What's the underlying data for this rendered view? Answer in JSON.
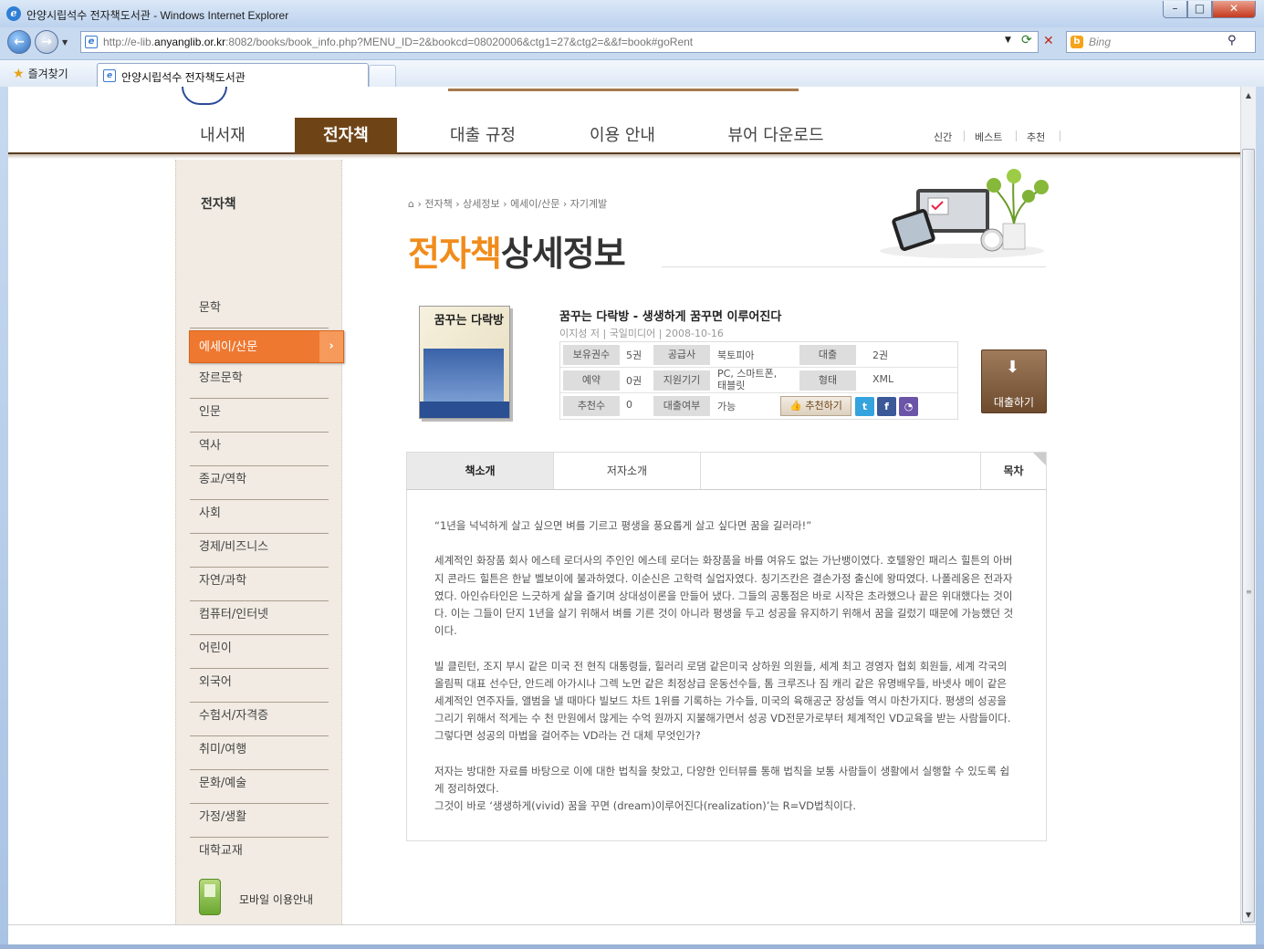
{
  "browser": {
    "window_title": "안양시립석수 전자책도서관 - Windows Internet Explorer",
    "url_prefix": "http://e-lib.",
    "url_domain": "anyanglib.or.kr",
    "url_rest": ":8082/books/book_info.php?MENU_ID=2&bookcd=08020006&ctg1=27&ctg2=&&f=book#goRent",
    "search_placeholder": "Bing",
    "favorites_label": "즐겨찾기",
    "tab_title": "안양시립석수 전자책도서관"
  },
  "gnb": {
    "items": [
      "내서재",
      "전자책",
      "대출 규정",
      "이용 안내",
      "뷰어 다운로드"
    ],
    "active": "전자책",
    "util": [
      "신간",
      "베스트",
      "추천"
    ]
  },
  "lnb": {
    "title": "전자책",
    "items": [
      "문학",
      "에세이/산문",
      "장르문학",
      "인문",
      "역사",
      "종교/역학",
      "사회",
      "경제/비즈니스",
      "자연/과학",
      "컴퓨터/인터넷",
      "어린이",
      "외국어",
      "수험서/자격증",
      "취미/여행",
      "문화/예술",
      "가정/생활",
      "대학교재"
    ],
    "active": "에세이/산문",
    "mobile_label": "모바일 이용안내"
  },
  "breadcrumb": [
    "전자책",
    "상세정보",
    "에세이/산문",
    "자기계발"
  ],
  "page_title": {
    "accent": "전자책",
    "rest": "상세정보"
  },
  "book": {
    "title": "꿈꾸는 다락방 - 생생하게 꿈꾸면 이루어진다",
    "author": "이지성 저",
    "publisher": "국일미디어",
    "date": "2008-10-16",
    "cover_text": "꿈꾸는 다락방",
    "labels": {
      "holdings": "보유권수",
      "supplier": "공급사",
      "loan": "대출",
      "reserve": "예약",
      "support": "지원기기",
      "format": "형태",
      "recommend": "추천수",
      "loanable": "대출여부"
    },
    "values": {
      "holdings": "5권",
      "supplier": "북토피아",
      "loan": "2권",
      "reserve": "0권",
      "support": "PC, 스마트폰, 태블릿",
      "format": "XML",
      "recommend": "0",
      "loanable": "가능"
    },
    "recommend_button": "추천하기",
    "rent_button": "대출하기"
  },
  "tabs": {
    "intro": "책소개",
    "author": "저자소개",
    "toc": "목차"
  },
  "description": [
    "“1년을 넉넉하게 살고 싶으면 벼를 기르고 평생을 풍요롭게 살고 싶다면 꿈을 길러라!”",
    "세계적인 화장품 회사 에스테 로더사의 주인인 에스테 로더는 화장품을 바를 여유도 없는 가난뱅이였다. 호텔왕인 패리스 힐튼의 아버지 콘라드 힐튼은 한낱 벨보이에 불과하였다. 이순신은 고학력 실업자였다. 칭기즈칸은 결손가정 출신에 왕따였다. 나폴레옹은 전과자였다. 아인슈타인은 느긋하게 삶을 즐기며 상대성이론을 만들어 냈다. 그들의 공통점은 바로 시작은 초라했으나 끝은 위대했다는 것이다. 이는 그들이 단지 1년을 살기 위해서 벼를 기른 것이 아니라 평생을 두고 성공을 유지하기 위해서 꿈을 길렀기 때문에 가능했던 것이다.",
    "빌 클린턴, 조지 부시 같은 미국 전 현직 대통령들, 힐러리 로댐 같은미국 상하원 의원들, 세계 최고 경영자 협회 회원들, 세계 각국의 올림픽 대표 선수단, 안드레 아가시나 그렉 노먼 같은 최정상급 운동선수들, 톰 크루즈나 짐 캐리 같은 유명배우들, 바넷사 메이 같은 세계적인 연주자들, 앨범을 낼 때마다 빌보드 차트 1위를 기록하는 가수들, 미국의 육해공군 장성들 역시 마찬가지다. 평생의 성공을 그리기 위해서 적게는 수 천 만원에서 많게는 수억 원까지 지불해가면서 성공 VD전문가로부터 체계적인 VD교육을 받는 사람들이다. 그렇다면 성공의 마법을 걸어주는 VD라는 건 대체 무엇인가?",
    "저자는 방대한 자료를 바탕으로 이에 대한 법칙을 찾았고, 다양한 인터뷰를 통해 법칙을 보통 사람들이 생활에서 실행할 수 있도록 쉽게 정리하였다.",
    "그것이 바로 ‘생생하게(vivid) 꿈을 꾸면 (dream)이루어진다(realization)’는 R=VD법칙이다."
  ]
}
